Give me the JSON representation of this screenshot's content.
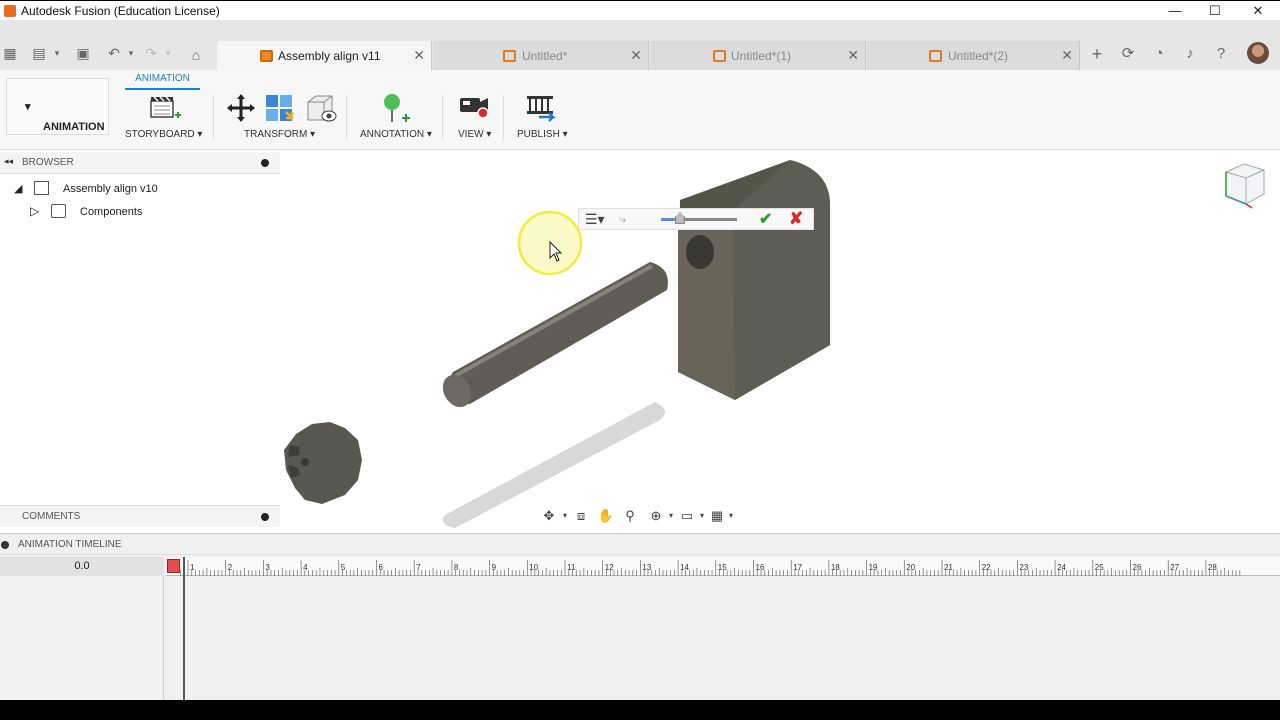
{
  "window": {
    "title": "Autodesk Fusion (Education License)",
    "controls": [
      "—",
      "☐",
      "✕"
    ]
  },
  "tabs": [
    {
      "label": "Assembly align v11",
      "active": true
    },
    {
      "label": "Untitled*",
      "active": false
    },
    {
      "label": "Untitled*(1)",
      "active": false
    },
    {
      "label": "Untitled*(2)",
      "active": false
    }
  ],
  "ribbon": {
    "workspace": "ANIMATION",
    "active_tab": "ANIMATION",
    "groups": {
      "storyboard": "STORYBOARD",
      "transform": "TRANSFORM",
      "annotation": "ANNOTATION",
      "view": "VIEW",
      "publish": "PUBLISH"
    }
  },
  "browser": {
    "header": "BROWSER",
    "root": "Assembly align v10",
    "child": "Components"
  },
  "comments": {
    "header": "COMMENTS"
  },
  "timeline": {
    "header": "ANIMATION TIMELINE",
    "time": "0.0",
    "ticks": [
      "1",
      "2",
      "3",
      "4",
      "5",
      "6",
      "7",
      "8",
      "9",
      "10",
      "11",
      "12",
      "13",
      "14",
      "15",
      "16",
      "17",
      "18",
      "19",
      "20",
      "21",
      "22",
      "23",
      "24",
      "25",
      "26",
      "27",
      "28"
    ]
  },
  "colors": {
    "accent": "#1a7fc8",
    "part": "#5b5a52",
    "confirm": "#2e9a2e",
    "cancel": "#d42b2b",
    "cursor_highlight": "#f2ec3a"
  }
}
